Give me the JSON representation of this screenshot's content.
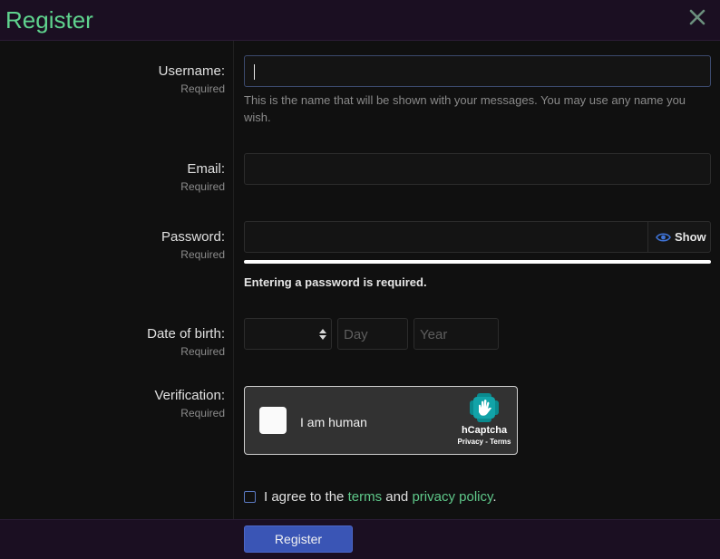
{
  "header": {
    "title": "Register",
    "close_icon": "close-icon"
  },
  "fields": {
    "username": {
      "label": "Username:",
      "required": "Required",
      "value": "",
      "hint": "This is the name that will be shown with your messages. You may use any name you wish."
    },
    "email": {
      "label": "Email:",
      "required": "Required",
      "value": ""
    },
    "password": {
      "label": "Password:",
      "required": "Required",
      "value": "",
      "show_label": "Show",
      "show_icon": "eye-icon",
      "strength_message": "Entering a password is required.",
      "strength_fill": 1.0,
      "strength_color": "#ffffff"
    },
    "dob": {
      "label": "Date of birth:",
      "required": "Required",
      "month_value": "",
      "day_placeholder": "Day",
      "year_placeholder": "Year"
    },
    "verification": {
      "label": "Verification:",
      "required": "Required",
      "checkbox_label": "I am human",
      "brand": "hCaptcha",
      "links": "Privacy - Terms"
    }
  },
  "agree": {
    "prefix": "I agree to the",
    "terms": "terms",
    "and": "and",
    "privacy": "privacy policy",
    "suffix": "."
  },
  "footer": {
    "register_label": "Register"
  },
  "colors": {
    "accent": "#5fd38e",
    "link": "#5fc98a",
    "button": "#3a55b5",
    "header_bg": "#1b0f22",
    "background": "#101010"
  }
}
